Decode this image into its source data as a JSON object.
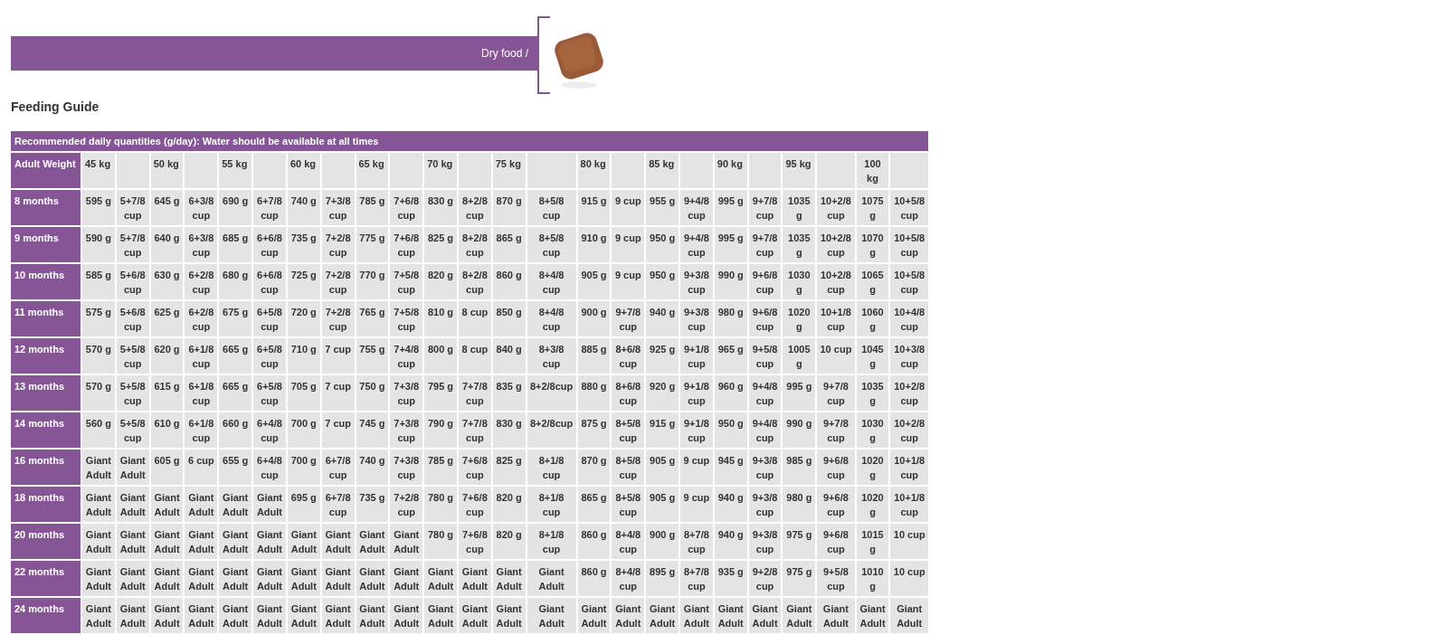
{
  "banner": {
    "text": "Dry food /"
  },
  "title": "Feeding Guide",
  "table": {
    "caption": "Recommended daily quantities (g/day): Water should be available at all times",
    "row_header": "Adult Weight",
    "columns": [
      "45 kg",
      "",
      "50 kg",
      "",
      "55 kg",
      "",
      "60 kg",
      "",
      "65 kg",
      "",
      "70 kg",
      "",
      "75 kg",
      "",
      "80 kg",
      "",
      "85 kg",
      "",
      "90 kg",
      "",
      "95 kg",
      "",
      "100 kg",
      ""
    ],
    "rows": [
      {
        "label": "8 months",
        "cells": [
          "595 g",
          "5+7/8 cup",
          "645 g",
          "6+3/8 cup",
          "690 g",
          "6+7/8 cup",
          "740 g",
          "7+3/8 cup",
          "785 g",
          "7+6/8 cup",
          "830 g",
          "8+2/8 cup",
          "870 g",
          "8+5/8 cup",
          "915 g",
          "9 cup",
          "955 g",
          "9+4/8 cup",
          "995 g",
          "9+7/8 cup",
          "1035 g",
          "10+2/8 cup",
          "1075 g",
          "10+5/8 cup"
        ]
      },
      {
        "label": "9 months",
        "cells": [
          "590 g",
          "5+7/8 cup",
          "640 g",
          "6+3/8 cup",
          "685 g",
          "6+6/8 cup",
          "735 g",
          "7+2/8 cup",
          "775 g",
          "7+6/8 cup",
          "825 g",
          "8+2/8 cup",
          "865 g",
          "8+5/8 cup",
          "910 g",
          "9 cup",
          "950 g",
          "9+4/8 cup",
          "995 g",
          "9+7/8 cup",
          "1035 g",
          "10+2/8 cup",
          "1070 g",
          "10+5/8 cup"
        ]
      },
      {
        "label": "10 months",
        "cells": [
          "585 g",
          "5+6/8 cup",
          "630 g",
          "6+2/8 cup",
          "680 g",
          "6+6/8 cup",
          "725 g",
          "7+2/8 cup",
          "770 g",
          "7+5/8 cup",
          "820 g",
          "8+2/8 cup",
          "860 g",
          "8+4/8 cup",
          "905 g",
          "9 cup",
          "950 g",
          "9+3/8 cup",
          "990 g",
          "9+6/8 cup",
          "1030 g",
          "10+2/8 cup",
          "1065 g",
          "10+5/8 cup"
        ]
      },
      {
        "label": "11 months",
        "cells": [
          "575 g",
          "5+6/8 cup",
          "625 g",
          "6+2/8 cup",
          "675 g",
          "6+5/8 cup",
          "720 g",
          "7+2/8 cup",
          "765 g",
          "7+5/8 cup",
          "810 g",
          "8 cup",
          "850 g",
          "8+4/8 cup",
          "900 g",
          "9+7/8 cup",
          "940 g",
          "9+3/8 cup",
          "980 g",
          "9+6/8 cup",
          "1020 g",
          "10+1/8 cup",
          "1060 g",
          "10+4/8 cup"
        ]
      },
      {
        "label": "12 months",
        "cells": [
          "570 g",
          "5+5/8 cup",
          "620 g",
          "6+1/8 cup",
          "665 g",
          "6+5/8 cup",
          "710 g",
          "7 cup",
          "755 g",
          "7+4/8 cup",
          "800 g",
          "8 cup",
          "840 g",
          "8+3/8 cup",
          "885 g",
          "8+6/8 cup",
          "925 g",
          "9+1/8 cup",
          "965 g",
          "9+5/8 cup",
          "1005 g",
          "10 cup",
          "1045 g",
          "10+3/8 cup"
        ]
      },
      {
        "label": "13 months",
        "cells": [
          "570 g",
          "5+5/8 cup",
          "615 g",
          "6+1/8 cup",
          "665 g",
          "6+5/8 cup",
          "705 g",
          "7 cup",
          "750 g",
          "7+3/8 cup",
          "795 g",
          "7+7/8 cup",
          "835 g",
          "8+2/8cup",
          "880 g",
          "8+6/8 cup",
          "920 g",
          "9+1/8 cup",
          "960 g",
          "9+4/8 cup",
          "995 g",
          "9+7/8 cup",
          "1035 g",
          "10+2/8 cup"
        ]
      },
      {
        "label": "14 months",
        "cells": [
          "560 g",
          "5+5/8 cup",
          "610 g",
          "6+1/8 cup",
          "660 g",
          "6+4/8 cup",
          "700 g",
          "7 cup",
          "745 g",
          "7+3/8 cup",
          "790 g",
          "7+7/8 cup",
          "830 g",
          "8+2/8cup",
          "875 g",
          "8+5/8 cup",
          "915 g",
          "9+1/8 cup",
          "950 g",
          "9+4/8 cup",
          "990 g",
          "9+7/8 cup",
          "1030 g",
          "10+2/8 cup"
        ]
      },
      {
        "label": "16 months",
        "cells": [
          "Giant Adult",
          "Giant Adult",
          "605 g",
          "6 cup",
          "655 g",
          "6+4/8 cup",
          "700 g",
          "6+7/8 cup",
          "740 g",
          "7+3/8 cup",
          "785 g",
          "7+6/8 cup",
          "825 g",
          "8+1/8 cup",
          "870 g",
          "8+5/8 cup",
          "905 g",
          "9 cup",
          "945 g",
          "9+3/8 cup",
          "985 g",
          "9+6/8 cup",
          "1020 g",
          "10+1/8 cup"
        ]
      },
      {
        "label": "18 months",
        "cells": [
          "Giant Adult",
          "Giant Adult",
          "Giant Adult",
          "Giant Adult",
          "Giant Adult",
          "Giant Adult",
          "695 g",
          "6+7/8 cup",
          "735 g",
          "7+2/8 cup",
          "780 g",
          "7+6/8 cup",
          "820 g",
          "8+1/8 cup",
          "865 g",
          "8+5/8 cup",
          "905 g",
          "9 cup",
          "940 g",
          "9+3/8 cup",
          "980 g",
          "9+6/8 cup",
          "1020 g",
          "10+1/8 cup"
        ]
      },
      {
        "label": "20 months",
        "cells": [
          "Giant Adult",
          "Giant Adult",
          "Giant Adult",
          "Giant Adult",
          "Giant Adult",
          "Giant Adult",
          "Giant Adult",
          "Giant Adult",
          "Giant Adult",
          "Giant Adult",
          "780 g",
          "7+6/8 cup",
          "820 g",
          "8+1/8 cup",
          "860 g",
          "8+4/8 cup",
          "900 g",
          "8+7/8 cup",
          "940 g",
          "9+3/8 cup",
          "975 g",
          "9+6/8 cup",
          "1015 g",
          "10 cup"
        ]
      },
      {
        "label": "22 months",
        "cells": [
          "Giant Adult",
          "Giant Adult",
          "Giant Adult",
          "Giant Adult",
          "Giant Adult",
          "Giant Adult",
          "Giant Adult",
          "Giant Adult",
          "Giant Adult",
          "Giant Adult",
          "Giant Adult",
          "Giant Adult",
          "Giant Adult",
          "Giant Adult",
          "860 g",
          "8+4/8 cup",
          "895 g",
          "8+7/8 cup",
          "935 g",
          "9+2/8 cup",
          "975 g",
          "9+5/8 cup",
          "1010 g",
          "10 cup"
        ]
      },
      {
        "label": "24 months",
        "cells": [
          "Giant Adult",
          "Giant Adult",
          "Giant Adult",
          "Giant Adult",
          "Giant Adult",
          "Giant Adult",
          "Giant Adult",
          "Giant Adult",
          "Giant Adult",
          "Giant Adult",
          "Giant Adult",
          "Giant Adult",
          "Giant Adult",
          "Giant Adult",
          "Giant Adult",
          "Giant Adult",
          "Giant Adult",
          "Giant Adult",
          "Giant Adult",
          "Giant Adult",
          "Giant Adult",
          "Giant Adult",
          "Giant Adult",
          "Giant Adult"
        ]
      }
    ]
  }
}
